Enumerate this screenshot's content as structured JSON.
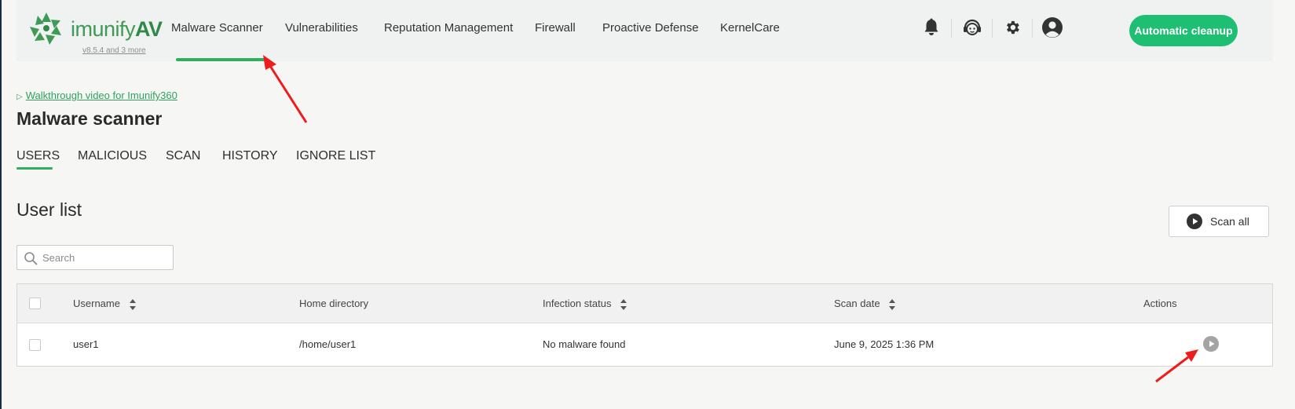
{
  "brand": {
    "name": "imunify",
    "name_suffix": "AV",
    "version": "v8.5.4 and 3 more",
    "color": "#3e9a56"
  },
  "nav": {
    "items": [
      {
        "label": "Malware Scanner",
        "active": true
      },
      {
        "label": "Vulnerabilities"
      },
      {
        "label": "Reputation Management"
      },
      {
        "label": "Firewall"
      },
      {
        "label": "Proactive Defense"
      },
      {
        "label": "KernelCare"
      }
    ],
    "icons": [
      "bell-icon",
      "support-agent-icon",
      "gear-icon",
      "user-avatar-icon"
    ],
    "cleanup_button": "Automatic cleanup",
    "accent": "#1fbf73"
  },
  "page": {
    "walkthrough_link": "Walkthrough video for Imunify360",
    "title": "Malware scanner",
    "tabs": [
      {
        "label": "USERS",
        "active": true
      },
      {
        "label": "MALICIOUS"
      },
      {
        "label": "SCAN"
      },
      {
        "label": "HISTORY"
      },
      {
        "label": "IGNORE LIST"
      }
    ]
  },
  "user_list": {
    "title": "User list",
    "scan_all": "Scan all",
    "search_placeholder": "Search",
    "columns": [
      "Username",
      "Home directory",
      "Infection status",
      "Scan date",
      "Actions"
    ],
    "rows": [
      {
        "username": "user1",
        "home": "/home/user1",
        "status": "No malware found",
        "scan_date": "June 9, 2025 1:36 PM"
      }
    ]
  },
  "annotation_color": "#ee1c1c"
}
